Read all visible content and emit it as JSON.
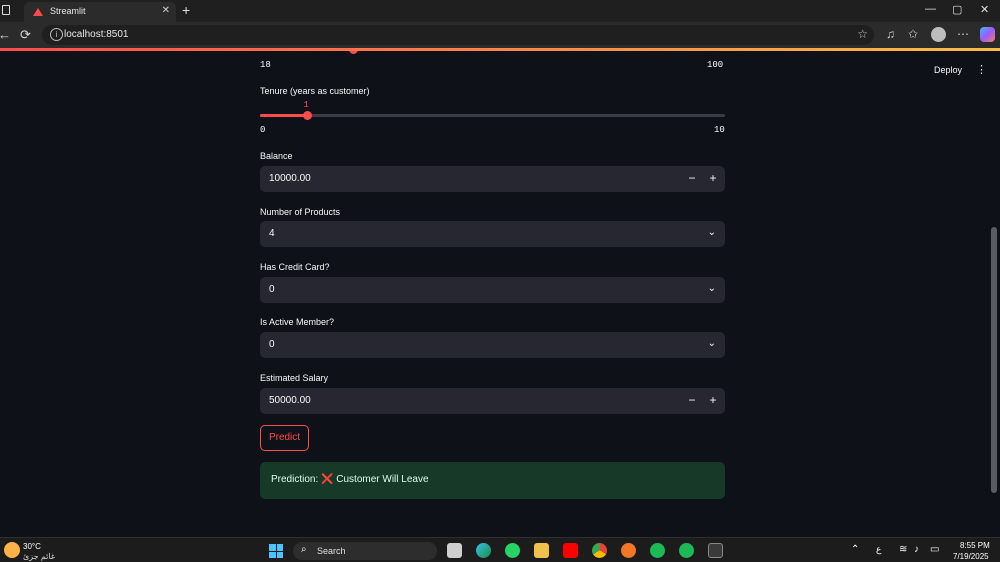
{
  "browser": {
    "tab_title": "Streamlit",
    "tab_close": "✕",
    "new_tab": "+",
    "url": "localhost:8501",
    "window_controls": [
      "—",
      "▢",
      "✕"
    ]
  },
  "app": {
    "deploy_label": "Deploy",
    "menu_icon": "⋮",
    "age_slider": {
      "min_label": "18",
      "max_label": "100",
      "fraction": 0.2
    },
    "tenure": {
      "label": "Tenure (years as customer)",
      "value": "1",
      "min_label": "0",
      "max_label": "10",
      "fraction": 0.1
    },
    "balance": {
      "label": "Balance",
      "value": "10000.00",
      "minus": "−",
      "plus": "+"
    },
    "num_products": {
      "label": "Number of Products",
      "value": "4"
    },
    "has_credit_card": {
      "label": "Has Credit Card?",
      "value": "0"
    },
    "is_active_member": {
      "label": "Is Active Member?",
      "value": "0"
    },
    "estimated_salary": {
      "label": "Estimated Salary",
      "value": "50000.00",
      "minus": "−",
      "plus": "+"
    },
    "predict_button": "Predict",
    "result": {
      "prefix": "Prediction: ",
      "icon": "❌",
      "text": " Customer Will Leave"
    }
  },
  "taskbar": {
    "weather_temp": "30°C",
    "weather_desc": "غائم جزئ",
    "search_label": "Search",
    "time": "8:55 PM",
    "date": "7/19/2025",
    "lang": "ع"
  }
}
